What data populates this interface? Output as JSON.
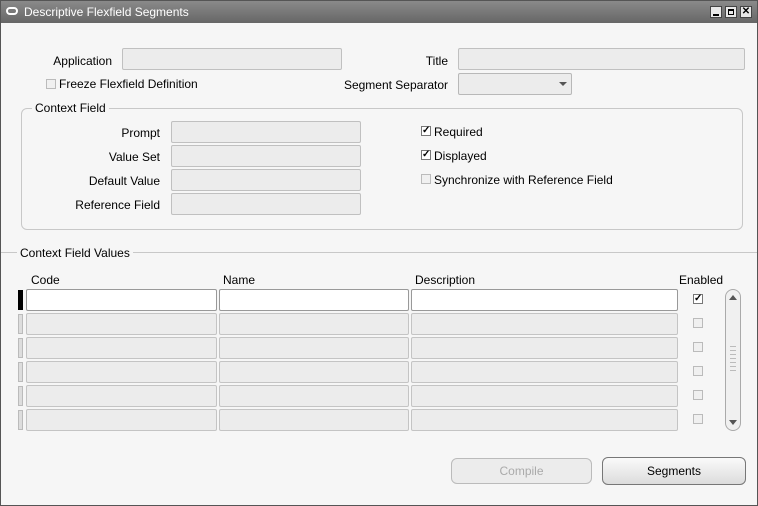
{
  "window": {
    "title": "Descriptive Flexfield Segments"
  },
  "header": {
    "application_label": "Application",
    "application_value": "",
    "title_label": "Title",
    "title_value": "",
    "freeze_label": "Freeze Flexfield Definition",
    "freeze_checked": false,
    "separator_label": "Segment Separator",
    "separator_value": ""
  },
  "context_field": {
    "group_title": "Context Field",
    "prompt_label": "Prompt",
    "value_set_label": "Value Set",
    "default_value_label": "Default Value",
    "reference_field_label": "Reference Field",
    "required_label": "Required",
    "required_checked": true,
    "displayed_label": "Displayed",
    "displayed_checked": true,
    "sync_label": "Synchronize with Reference Field",
    "sync_checked": false
  },
  "context_values": {
    "section_title": "Context Field Values",
    "columns": {
      "code": "Code",
      "name": "Name",
      "description": "Description",
      "enabled": "Enabled"
    },
    "rows": [
      {
        "code": "",
        "name": "",
        "description": "",
        "enabled": true
      },
      {
        "code": "",
        "name": "",
        "description": "",
        "enabled": false
      },
      {
        "code": "",
        "name": "",
        "description": "",
        "enabled": false
      },
      {
        "code": "",
        "name": "",
        "description": "",
        "enabled": false
      },
      {
        "code": "",
        "name": "",
        "description": "",
        "enabled": false
      },
      {
        "code": "",
        "name": "",
        "description": "",
        "enabled": false
      }
    ]
  },
  "buttons": {
    "compile_label": "Compile",
    "segments_label": "Segments"
  },
  "icons": {
    "window": "window-icon",
    "minimize": "minimize-icon",
    "maximize": "maximize-icon",
    "close": "close-icon",
    "check": "checkmark-icon",
    "scroll_up": "scroll-up-icon",
    "scroll_down": "scroll-down-icon"
  }
}
